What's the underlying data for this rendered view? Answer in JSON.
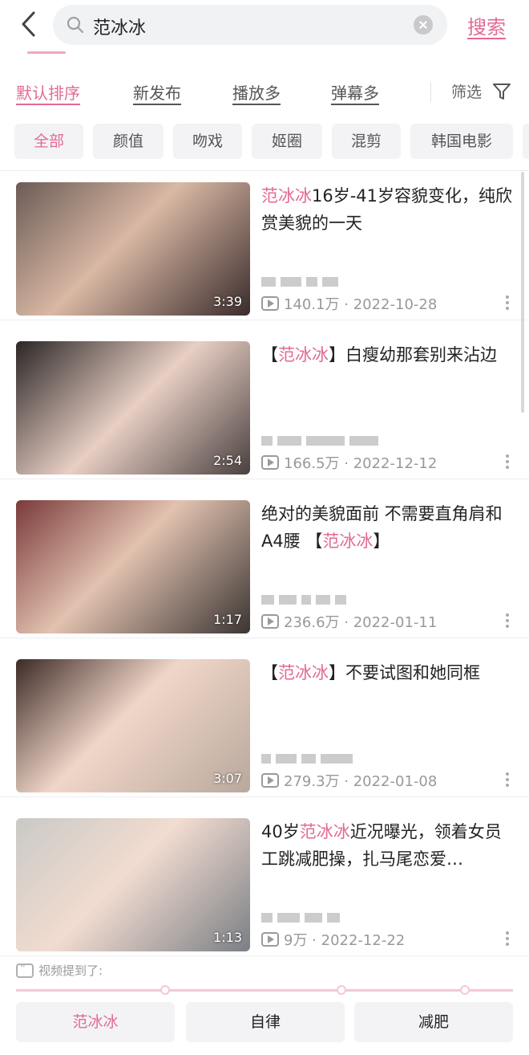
{
  "header": {
    "query": "范冰冰",
    "search_label": "搜索"
  },
  "sort": {
    "options": [
      "默认排序",
      "新发布",
      "播放多",
      "弹幕多"
    ],
    "active_index": 0,
    "filter_label": "筛选"
  },
  "categories": {
    "items": [
      "全部",
      "颜值",
      "吻戏",
      "姬圈",
      "混剪",
      "韩国电影"
    ],
    "active_index": 0
  },
  "results": [
    {
      "title_parts": [
        {
          "text": "范冰冰",
          "hl": true
        },
        {
          "text": "16岁-41岁容貌变化，纯欣赏美貌的一天",
          "hl": false
        }
      ],
      "duration": "3:39",
      "views": "140.1万",
      "date": "2022-10-28"
    },
    {
      "title_parts": [
        {
          "text": "【",
          "hl": false
        },
        {
          "text": "范冰冰",
          "hl": true
        },
        {
          "text": "】白瘦幼那套别来沾边",
          "hl": false
        }
      ],
      "duration": "2:54",
      "views": "166.5万",
      "date": "2022-12-12"
    },
    {
      "title_parts": [
        {
          "text": "绝对的美貌面前 不需要直角肩和A4腰 【",
          "hl": false
        },
        {
          "text": "范冰冰",
          "hl": true
        },
        {
          "text": "】",
          "hl": false
        }
      ],
      "duration": "1:17",
      "views": "236.6万",
      "date": "2022-01-11"
    },
    {
      "title_parts": [
        {
          "text": "【",
          "hl": false
        },
        {
          "text": "范冰冰",
          "hl": true
        },
        {
          "text": "】不要试图和她同框",
          "hl": false
        }
      ],
      "duration": "3:07",
      "views": "279.3万",
      "date": "2022-01-08"
    },
    {
      "title_parts": [
        {
          "text": "40岁",
          "hl": false
        },
        {
          "text": "范冰冰",
          "hl": true
        },
        {
          "text": "近况曝光，领着女员工跳减肥操，扎马尾恋爱…",
          "hl": false
        }
      ],
      "duration": "1:13",
      "views": "9万",
      "date": "2022-12-22"
    }
  ],
  "mentioned": {
    "label": "视频提到了:",
    "tags": [
      "范冰冰",
      "自律",
      "减肥"
    ],
    "active_index": 0
  },
  "colors": {
    "accent": "#e26a96",
    "chip_bg": "#f3f3f5",
    "meta_text": "#999999"
  }
}
